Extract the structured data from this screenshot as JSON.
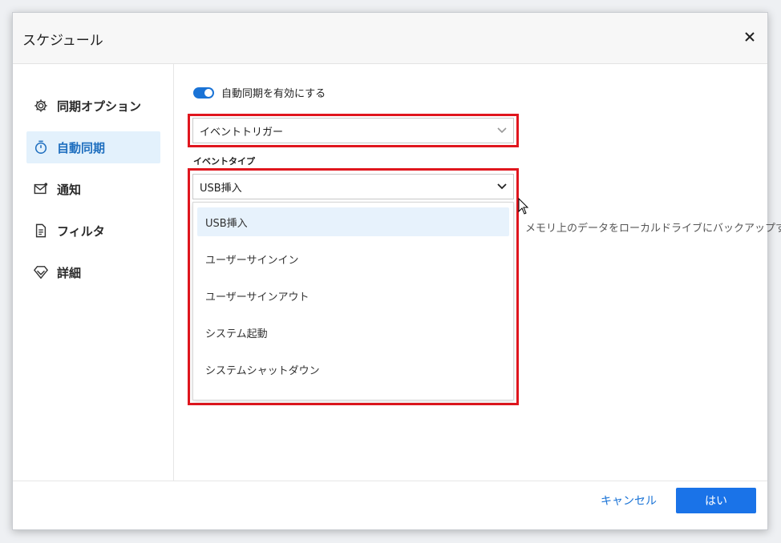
{
  "dialog": {
    "title": "スケジュール"
  },
  "sidebar": {
    "items": [
      {
        "label": "同期オプション",
        "icon": "gear-icon",
        "active": false
      },
      {
        "label": "自動同期",
        "icon": "timer-icon",
        "active": true
      },
      {
        "label": "通知",
        "icon": "mail-icon",
        "active": false
      },
      {
        "label": "フィルタ",
        "icon": "document-icon",
        "active": false
      },
      {
        "label": "詳細",
        "icon": "diamond-icon",
        "active": false
      }
    ]
  },
  "main": {
    "toggle": {
      "label": "自動同期を有効にする",
      "on": true
    },
    "trigger_select": {
      "value": "イベントトリガー"
    },
    "event_type": {
      "label": "イベントタイプ",
      "value": "USB挿入",
      "options": [
        "USB挿入",
        "ユーザーサインイン",
        "ユーザーサインアウト",
        "システム起動",
        "システムシャットダウン"
      ],
      "selected_index": 0
    },
    "hint": "メモリ上のデータをローカルドライブにバックアップする"
  },
  "footer": {
    "cancel_label": "キャンセル",
    "ok_label": "はい"
  },
  "colors": {
    "accent": "#1a73e8",
    "highlight_box": "#e0161e",
    "active_item_bg": "#e3f1fc"
  }
}
